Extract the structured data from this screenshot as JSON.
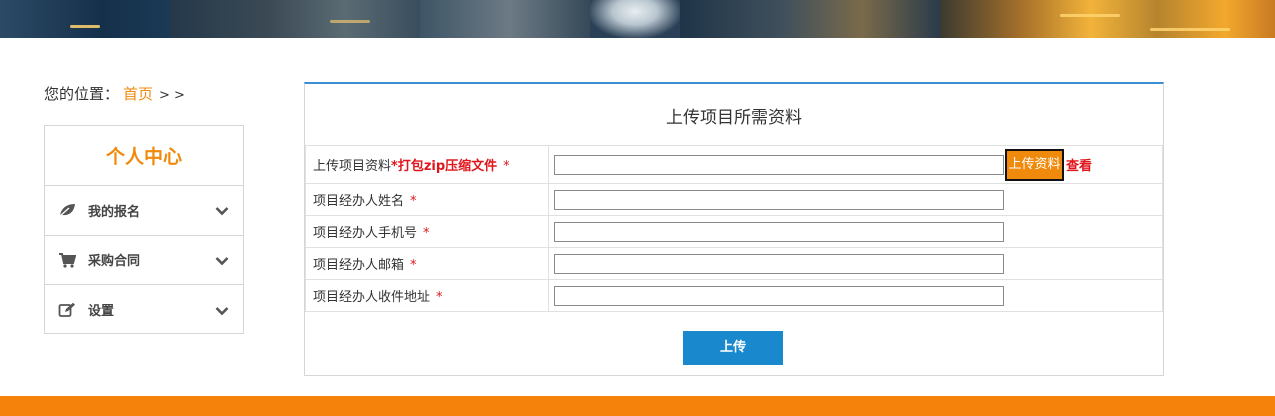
{
  "breadcrumb": {
    "prefix": "您的位置：",
    "home": "首页",
    "separator": "> >"
  },
  "sidebar": {
    "title": "个人中心",
    "items": [
      {
        "label": "我的报名",
        "icon": "leaf-icon"
      },
      {
        "label": "采购合同",
        "icon": "cart-icon"
      },
      {
        "label": "设置",
        "icon": "edit-icon"
      }
    ]
  },
  "form": {
    "title": "上传项目所需资料",
    "rows": [
      {
        "label": "上传项目资料",
        "hint": "*打包zip压缩文件",
        "required": "*",
        "value": "",
        "upload_label": "上传资料",
        "view_label": "查看"
      },
      {
        "label": "项目经办人姓名",
        "required": "*",
        "value": ""
      },
      {
        "label": "项目经办人手机号",
        "required": "*",
        "value": ""
      },
      {
        "label": "项目经办人邮箱",
        "required": "*",
        "value": ""
      },
      {
        "label": "项目经办人收件地址",
        "required": "*",
        "value": ""
      }
    ],
    "submit_label": "上传"
  },
  "colors": {
    "accent_orange": "#f08a0c",
    "primary_blue": "#1a88cc",
    "required_red": "#e0161c",
    "footer_orange": "#f5820b"
  }
}
